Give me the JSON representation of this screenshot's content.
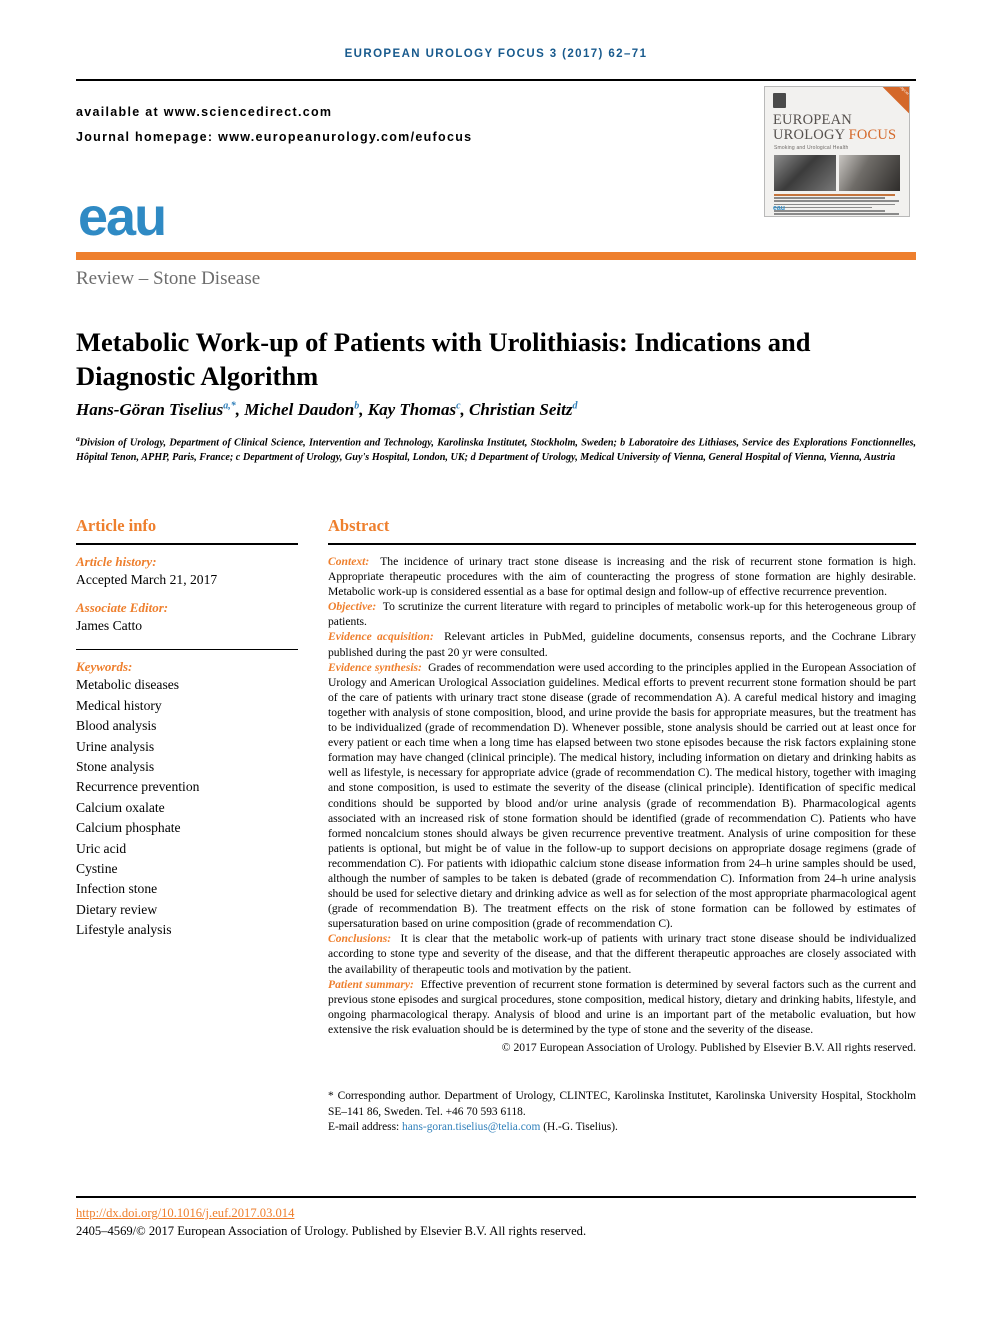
{
  "running_head": "EUROPEAN UROLOGY FOCUS 3 (2017) 62–71",
  "availability": {
    "line1": "available at www.sciencedirect.com",
    "line2": "Journal homepage: www.europeanurology.com/eufocus"
  },
  "cover": {
    "corner_badge": "Smoking and Urological Health",
    "title_part1": "EUROPEAN",
    "title_part2": "UROLOGY",
    "title_focus": "FOCUS",
    "subtitle": "Smoking and Urological Health",
    "society": "eau"
  },
  "logo": {
    "text": "eau"
  },
  "section_kicker": "Review – Stone Disease",
  "title": "Metabolic Work-up of Patients with Urolithiasis: Indications and Diagnostic Algorithm",
  "authors": [
    {
      "name": "Hans-Göran Tiselius",
      "sup": "a,*"
    },
    {
      "name": "Michel Daudon",
      "sup": "b"
    },
    {
      "name": "Kay Thomas",
      "sup": "c"
    },
    {
      "name": "Christian Seitz",
      "sup": "d"
    }
  ],
  "affiliations": "Division of Urology, Department of Clinical Science, Intervention and Technology, Karolinska Institutet, Stockholm, Sweden; b Laboratoire des Lithiases, Service des Explorations Fonctionnelles, Hôpital Tenon, APHP, Paris, France; c Department of Urology, Guy's Hospital, London, UK; d Department of Urology, Medical University of Vienna, General Hospital of Vienna, Vienna, Austria",
  "article_info": {
    "heading": "Article info",
    "history_label": "Article history:",
    "history_value": "Accepted March 21, 2017",
    "editor_label": "Associate Editor:",
    "editor_value": "James Catto",
    "keywords_label": "Keywords:",
    "keywords": [
      "Metabolic diseases",
      "Medical history",
      "Blood analysis",
      "Urine analysis",
      "Stone analysis",
      "Recurrence prevention",
      "Calcium oxalate",
      "Calcium phosphate",
      "Uric acid",
      "Cystine",
      "Infection stone",
      "Dietary review",
      "Lifestyle analysis"
    ]
  },
  "abstract": {
    "heading": "Abstract",
    "context_label": "Context:",
    "context_text": "The incidence of urinary tract stone disease is increasing and the risk of recurrent stone formation is high. Appropriate therapeutic procedures with the aim of counteracting the progress of stone formation are highly desirable. Metabolic work-up is considered essential as a base for optimal design and follow-up of effective recurrence prevention.",
    "objective_label": "Objective:",
    "objective_text": "To scrutinize the current literature with regard to principles of metabolic work-up for this heterogeneous group of patients.",
    "acquisition_label": "Evidence acquisition:",
    "acquisition_text": "Relevant articles in PubMed, guideline documents, consensus reports, and the Cochrane Library published during the past 20 yr were consulted.",
    "synthesis_label": "Evidence synthesis:",
    "synthesis_text": "Grades of recommendation were used according to the principles applied in the European Association of Urology and American Urological Association guidelines. Medical efforts to prevent recurrent stone formation should be part of the care of patients with urinary tract stone disease (grade of recommendation A). A careful medical history and imaging together with analysis of stone composition, blood, and urine provide the basis for appropriate measures, but the treatment has to be individualized (grade of recommendation D). Whenever possible, stone analysis should be carried out at least once for every patient or each time when a long time has elapsed between two stone episodes because the risk factors explaining stone formation may have changed (clinical principle). The medical history, including information on dietary and drinking habits as well as lifestyle, is necessary for appropriate advice (grade of recommendation C). The medical history, together with imaging and stone composition, is used to estimate the severity of the disease (clinical principle). Identification of specific medical conditions should be supported by blood and/or urine analysis (grade of recommendation B). Pharmacological agents associated with an increased risk of stone formation should be identified (grade of recommendation C). Patients who have formed noncalcium stones should always be given recurrence preventive treatment. Analysis of urine composition for these patients is optional, but might be of value in the follow-up to support decisions on appropriate dosage regimens (grade of recommendation C). For patients with idiopathic calcium stone disease information from 24–h urine samples should be used, although the number of samples to be taken is debated (grade of recommendation C). Information from 24–h urine analysis should be used for selective dietary and drinking advice as well as for selection of the most appropriate pharmacological agent (grade of recommendation B). The treatment effects on the risk of stone formation can be followed by estimates of supersaturation based on urine composition (grade of recommendation C).",
    "conclusions_label": "Conclusions:",
    "conclusions_text": "It is clear that the metabolic work-up of patients with urinary tract stone disease should be individualized according to stone type and severity of the disease, and that the different therapeutic approaches are closely associated with the availability of therapeutic tools and motivation by the patient.",
    "patient_summary_label": "Patient summary:",
    "patient_summary_text": "Effective prevention of recurrent stone formation is determined by several factors such as the current and previous stone episodes and surgical procedures, stone composition, medical history, dietary and drinking habits, lifestyle, and ongoing pharmacological therapy. Analysis of blood and urine is an important part of the metabolic evaluation, but how extensive the risk evaluation should be is determined by the type of stone and the severity of the disease.",
    "copyright": "© 2017 European Association of Urology. Published by Elsevier B.V. All rights reserved."
  },
  "corresponding": {
    "line": "* Corresponding author. Department of Urology, CLINTEC, Karolinska Institutet, Karolinska University Hospital, Stockholm SE–141 86, Sweden. Tel. +46 70 593 6118.",
    "email_label": "E-mail address:",
    "email": "hans-goran.tiselius@telia.com",
    "email_suffix": "(H.-G. Tiselius)."
  },
  "footer": {
    "doi": "http://dx.doi.org/10.1016/j.euf.2017.03.014",
    "issn": "2405–4569/© 2017 European Association of Urology. Published by Elsevier B.V. All rights reserved."
  },
  "colors": {
    "orange": "#ee7f2d",
    "blue": "#2f8ac4",
    "header_blue": "#185a8d"
  }
}
